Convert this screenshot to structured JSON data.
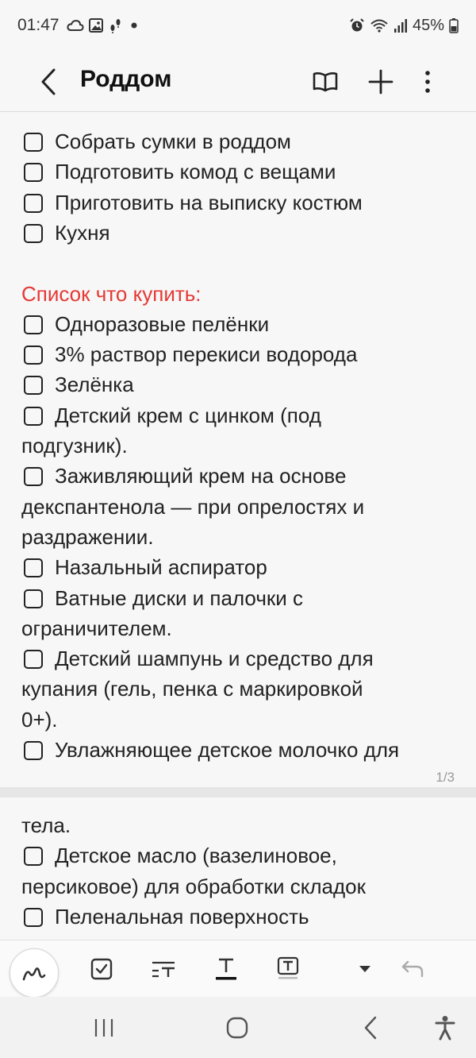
{
  "status_bar": {
    "time": "01:47",
    "battery": "45%"
  },
  "app_bar": {
    "title": "Роддом"
  },
  "colors": {
    "heading": "#e53935",
    "text": "#222222",
    "background": "#f7f7f7"
  },
  "note": {
    "page1": [
      {
        "text": "Собрать сумки в роддом",
        "checkbox": true
      },
      {
        "text": "Подготовить комод с вещами",
        "checkbox": true
      },
      {
        "text": "Приготовить на выписку костюм",
        "checkbox": true
      },
      {
        "text": "Кухня",
        "checkbox": true
      },
      {
        "text": "Список что купить:",
        "heading": true
      },
      {
        "text": "Одноразовые пелёнки",
        "checkbox": true
      },
      {
        "text": "3% раствор перекиси водорода",
        "checkbox": true
      },
      {
        "text": "Зелёнка",
        "checkbox": true
      },
      {
        "text": "Детский крем с цинком (под",
        "checkbox": true
      },
      {
        "text": "подгузник)."
      },
      {
        "text": "Заживляющий крем на основе",
        "checkbox": true
      },
      {
        "text": "декспантенола — при опрелостях и"
      },
      {
        "text": "раздражении."
      },
      {
        "text": "Назальный аспиратор",
        "checkbox": true
      },
      {
        "text": "Ватные диски и палочки с",
        "checkbox": true
      },
      {
        "text": "ограничителем."
      },
      {
        "text": "Детский шампунь и средство для",
        "checkbox": true
      },
      {
        "text": "купания (гель, пенка с маркировкой"
      },
      {
        "text": "0+)."
      },
      {
        "text": "Увлажняющее детское молочко для",
        "checkbox": true
      }
    ],
    "page_indicator": "1/3",
    "page2": [
      {
        "text": "тела."
      },
      {
        "text": "Детское масло (вазелиновое,",
        "checkbox": true
      },
      {
        "text": "персиковое) для обработки складок"
      },
      {
        "text": "Пеленальная поверхность",
        "checkbox": true
      }
    ]
  },
  "toolbar": {
    "icons": [
      "pen-mode-icon",
      "checkbox-icon",
      "text-style-icon",
      "text-color-icon",
      "text-highlight-icon",
      "dropdown-icon",
      "undo-icon"
    ]
  }
}
